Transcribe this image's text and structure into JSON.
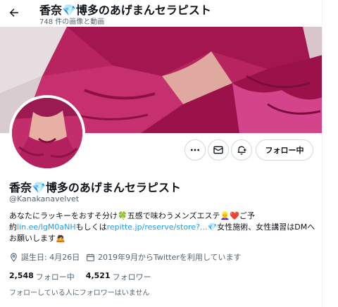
{
  "header": {
    "name": "香奈💎博多のあげまんセラピスト",
    "sub": "748 件の画像と動画"
  },
  "profile": {
    "name": "香奈💎博多のあげまんセラピスト",
    "handle": "@Kanakanavelvet",
    "follow_label": "フォロー中",
    "bio": {
      "line1_text": "あなたにラッキーをおすそ分け🍀五感で味わうメンズエステ👱‍♀️❤️ご予",
      "line2_prefix": "約",
      "link1": "lin.ee/lgM0aNH",
      "line2_mid": "もしくは",
      "link2": "repitte.jp/reserve/store?...",
      "line2_suffix": "💎女性施術、女性講習はDMへ",
      "line3_text": "お願いします🙇"
    },
    "location_label": "誕生日: 4月26日",
    "joined_label": "2019年9月からTwitterを利用しています",
    "following_count": "2,548",
    "following_label": "フォロー中",
    "followers_count": "4,521",
    "followers_label": "フォロワー",
    "mutual_note": "フォローしている人にフォロワーはいません"
  },
  "icons": [
    "back-arrow-icon",
    "more-icon",
    "mail-icon",
    "notification-plus-icon",
    "birthday-icon",
    "calendar-icon"
  ],
  "colors": {
    "link": "#1d9bf0",
    "muted": "#536471",
    "text": "#0f1419",
    "dress": "#b02563"
  }
}
